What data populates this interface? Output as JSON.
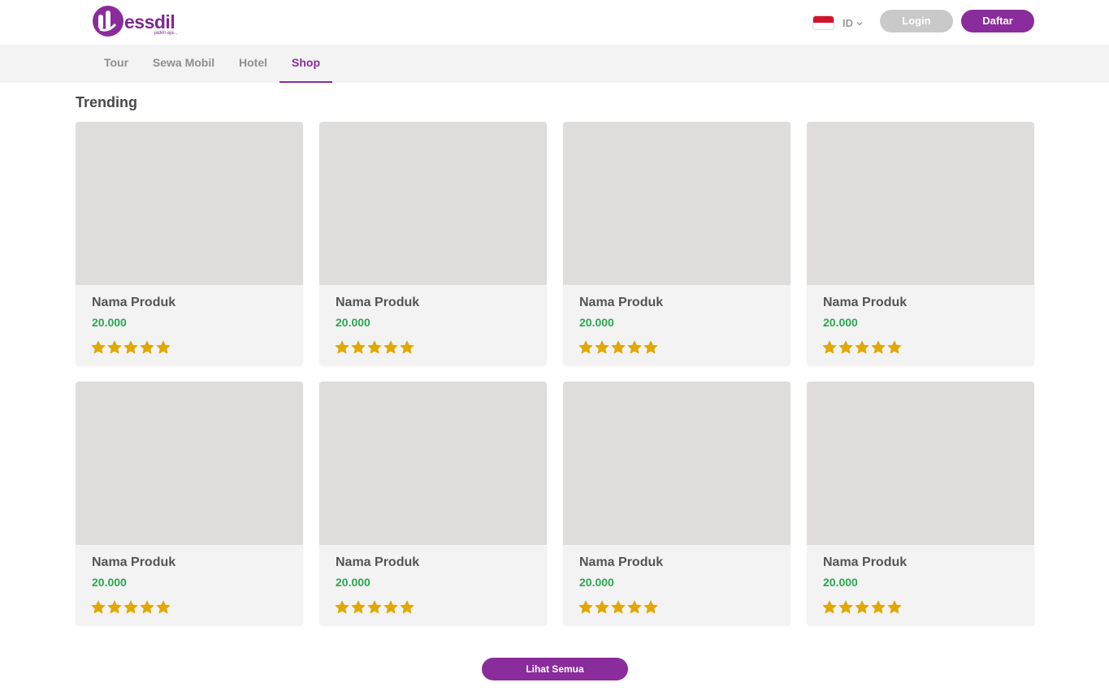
{
  "header": {
    "logo_text": "essdil",
    "logo_tagline": "jadiin aja...",
    "language": "ID",
    "login_label": "Login",
    "register_label": "Daftar"
  },
  "nav": {
    "tabs": [
      {
        "label": "Tour",
        "active": false
      },
      {
        "label": "Sewa Mobil",
        "active": false
      },
      {
        "label": "Hotel",
        "active": false
      },
      {
        "label": "Shop",
        "active": true
      }
    ]
  },
  "section": {
    "title": "Trending"
  },
  "products": [
    {
      "name": "Nama Produk",
      "price": "20.000",
      "rating": 5
    },
    {
      "name": "Nama Produk",
      "price": "20.000",
      "rating": 5
    },
    {
      "name": "Nama Produk",
      "price": "20.000",
      "rating": 5
    },
    {
      "name": "Nama Produk",
      "price": "20.000",
      "rating": 5
    },
    {
      "name": "Nama Produk",
      "price": "20.000",
      "rating": 5
    },
    {
      "name": "Nama Produk",
      "price": "20.000",
      "rating": 5
    },
    {
      "name": "Nama Produk",
      "price": "20.000",
      "rating": 5
    },
    {
      "name": "Nama Produk",
      "price": "20.000",
      "rating": 5
    }
  ],
  "view_all_label": "Lihat Semua",
  "colors": {
    "brand": "#8a2c9c",
    "price": "#2aa74f",
    "star": "#e0a800",
    "image_placeholder": "#dedddc",
    "card_bg": "#f3f3f3"
  },
  "icons": {
    "language_flag": "indonesia-flag-icon",
    "language_dropdown": "chevron-down-icon",
    "rating": "star-icon"
  }
}
